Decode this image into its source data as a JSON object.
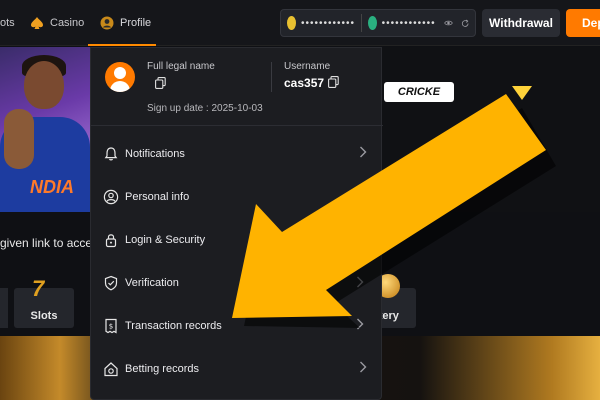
{
  "nav": {
    "items": [
      {
        "label": "ots"
      },
      {
        "label": "Casino"
      },
      {
        "label": "Profile"
      }
    ],
    "balance_1": "••••••••••••",
    "balance_2": "••••••••••••",
    "withdrawal_label": "Withdrawal",
    "deposit_label": "Dep",
    "accent_color": "#ff7a00"
  },
  "background": {
    "hero_link_text": "given link to access",
    "jersey_text": "NDIA",
    "cricket_label": "CRICKE",
    "categories": [
      {
        "label": "Slots"
      },
      {
        "label": "ttery"
      }
    ]
  },
  "profile_menu": {
    "legal_name_label": "Full legal name",
    "signup_date": "Sign up date : 2025-10-03",
    "username_label": "Username",
    "username_value": "cas357",
    "items": [
      {
        "label": "Notifications",
        "icon": "bell-icon"
      },
      {
        "label": "Personal info",
        "icon": "user-circle-icon"
      },
      {
        "label": "Login & Security",
        "icon": "lock-icon"
      },
      {
        "label": "Verification",
        "icon": "shield-check-icon"
      },
      {
        "label": "Transaction records",
        "icon": "receipt-icon"
      },
      {
        "label": "Betting records",
        "icon": "home-bet-icon"
      }
    ]
  },
  "annotation": {
    "arrow_color": "#ffb300",
    "icon": "arrow-pointer-icon"
  }
}
